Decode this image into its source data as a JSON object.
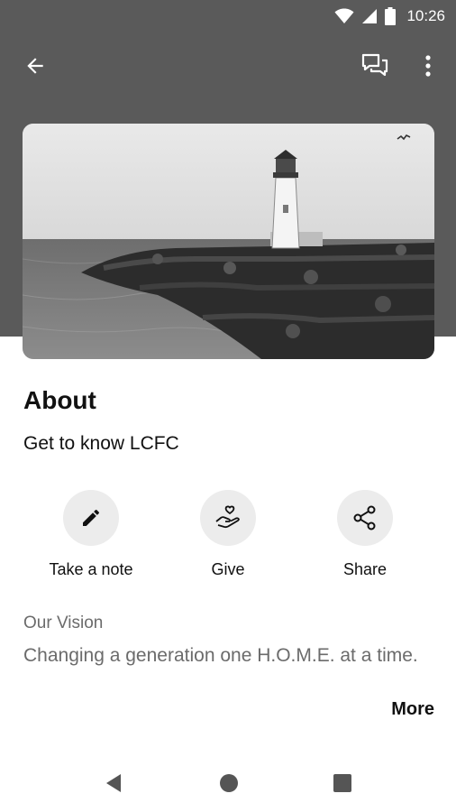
{
  "status_bar": {
    "time": "10:26",
    "icons": [
      "wifi-icon",
      "cell-signal-icon",
      "battery-icon"
    ]
  },
  "app_bar": {
    "icons": [
      "back-arrow-icon",
      "chat-icon",
      "more-vert-icon"
    ]
  },
  "hero_image": {
    "subject": "lighthouse-on-rock-jetty"
  },
  "about": {
    "title": "About",
    "subtitle": "Get to know LCFC"
  },
  "actions": [
    {
      "label": "Take a note",
      "icon": "pencil-icon"
    },
    {
      "label": "Give",
      "icon": "heart-hand-icon"
    },
    {
      "label": "Share",
      "icon": "share-icon"
    }
  ],
  "vision": {
    "title": "Our Vision",
    "text": "Changing a generation one H.O.M.E. at a time."
  },
  "more_label": "More",
  "nav_bar": {
    "icons": [
      "nav-back-icon",
      "nav-home-icon",
      "nav-recents-icon"
    ]
  },
  "colors": {
    "header_background": "#5a5a5a",
    "action_circle": "#ececec",
    "muted_text": "#6b6b6b"
  }
}
